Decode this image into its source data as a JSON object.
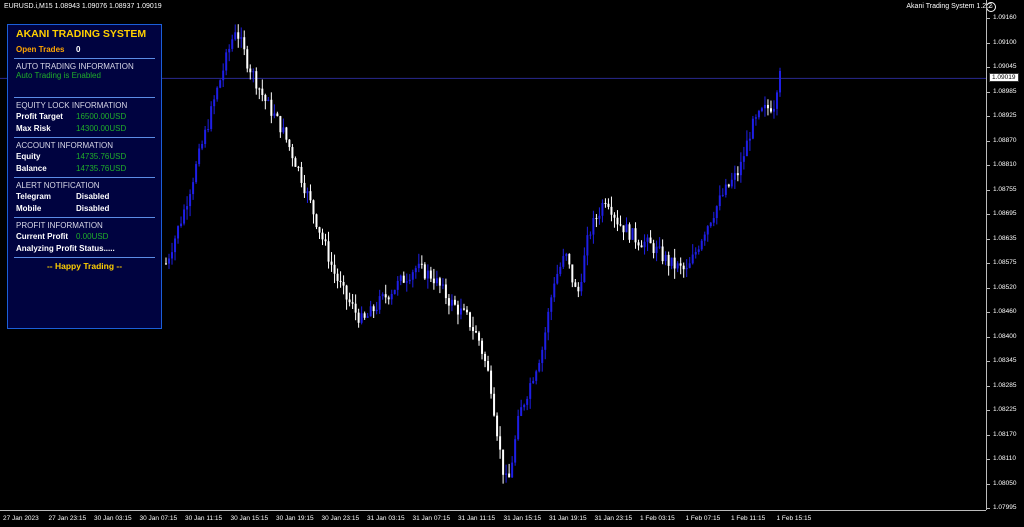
{
  "header": {
    "symbol_info": "EURUSD.i,M15  1.08943 1.09076 1.08937 1.09019",
    "ea_status": "Akani Trading System 1.2.2"
  },
  "panel": {
    "title": "AKANI TRADING SYSTEM",
    "open_trades_label": "Open Trades",
    "open_trades_value": "0",
    "auto_section": "AUTO TRADING INFORMATION",
    "auto_status": "Auto Trading is Enabled",
    "equity_section": "EQUITY LOCK INFORMATION",
    "profit_target_label": "Profit Target",
    "profit_target_value": "16500.00USD",
    "max_risk_label": "Max Risk",
    "max_risk_value": "14300.00USD",
    "account_section": "ACCOUNT INFORMATION",
    "equity_label": "Equity",
    "equity_value": "14735.76USD",
    "balance_label": "Balance",
    "balance_value": "14735.76USD",
    "alert_section": "ALERT NOTIFICATION",
    "telegram_label": "Telegram",
    "telegram_value": "Disabled",
    "mobile_label": "Mobile",
    "mobile_value": "Disabled",
    "profit_section": "PROFIT INFORMATION",
    "current_profit_label": "Current Profit",
    "current_profit_value": "0.00USD",
    "analyzing": "Analyzing Profit Status.....",
    "footer": "--  Happy Trading  --"
  },
  "price_axis": {
    "ticks": [
      "1.09160",
      "1.09100",
      "1.09045",
      "1.08985",
      "1.08925",
      "1.08870",
      "1.08810",
      "1.08755",
      "1.08695",
      "1.08635",
      "1.08575",
      "1.08520",
      "1.08460",
      "1.08400",
      "1.08345",
      "1.08285",
      "1.08225",
      "1.08170",
      "1.08110",
      "1.08050",
      "1.07995"
    ],
    "current": "1.09019"
  },
  "time_axis": {
    "ticks": [
      "27 Jan 2023",
      "27 Jan 23:15",
      "30 Jan 03:15",
      "30 Jan 07:15",
      "30 Jan 11:15",
      "30 Jan 15:15",
      "30 Jan 19:15",
      "30 Jan 23:15",
      "31 Jan 03:15",
      "31 Jan 07:15",
      "31 Jan 11:15",
      "31 Jan 15:15",
      "31 Jan 19:15",
      "31 Jan 23:15",
      "1 Feb 03:15",
      "1 Feb 07:15",
      "1 Feb 11:15",
      "1 Feb 15:15"
    ]
  },
  "chart_data": {
    "type": "candlestick",
    "symbol": "EURUSD.i",
    "timeframe": "M15",
    "ylim": [
      1.07995,
      1.0916
    ],
    "current_price": 1.09019,
    "bull_color": "#1e1ee6",
    "bear_color": "#ffffff",
    "path": [
      [
        0,
        1.0858
      ],
      [
        3,
        1.087
      ],
      [
        6,
        1.0885
      ],
      [
        9,
        1.09
      ],
      [
        12,
        1.0914
      ],
      [
        14,
        1.0906
      ],
      [
        17,
        1.0897
      ],
      [
        20,
        1.089
      ],
      [
        23,
        1.088
      ],
      [
        26,
        1.0868
      ],
      [
        29,
        1.0856
      ],
      [
        31,
        1.085
      ],
      [
        34,
        1.0844
      ],
      [
        37,
        1.0849
      ],
      [
        40,
        1.0853
      ],
      [
        43,
        1.0857
      ],
      [
        46,
        1.0855
      ],
      [
        49,
        1.0849
      ],
      [
        52,
        1.0845
      ],
      [
        54,
        1.084
      ],
      [
        56,
        1.083
      ],
      [
        58,
        1.081
      ],
      [
        59,
        1.0805
      ],
      [
        61,
        1.0822
      ],
      [
        63,
        1.083
      ],
      [
        65,
        1.0838
      ],
      [
        67,
        1.0854
      ],
      [
        69,
        1.086
      ],
      [
        71,
        1.085
      ],
      [
        73,
        1.0865
      ],
      [
        76,
        1.0874
      ],
      [
        78,
        1.0868
      ],
      [
        81,
        1.0864
      ],
      [
        84,
        1.0862
      ],
      [
        87,
        1.0858
      ],
      [
        90,
        1.0856
      ],
      [
        93,
        1.0866
      ],
      [
        96,
        1.0874
      ],
      [
        99,
        1.088
      ],
      [
        101,
        1.089
      ],
      [
        103,
        1.0894
      ],
      [
        105,
        1.0896
      ],
      [
        106,
        1.0905
      ]
    ]
  }
}
